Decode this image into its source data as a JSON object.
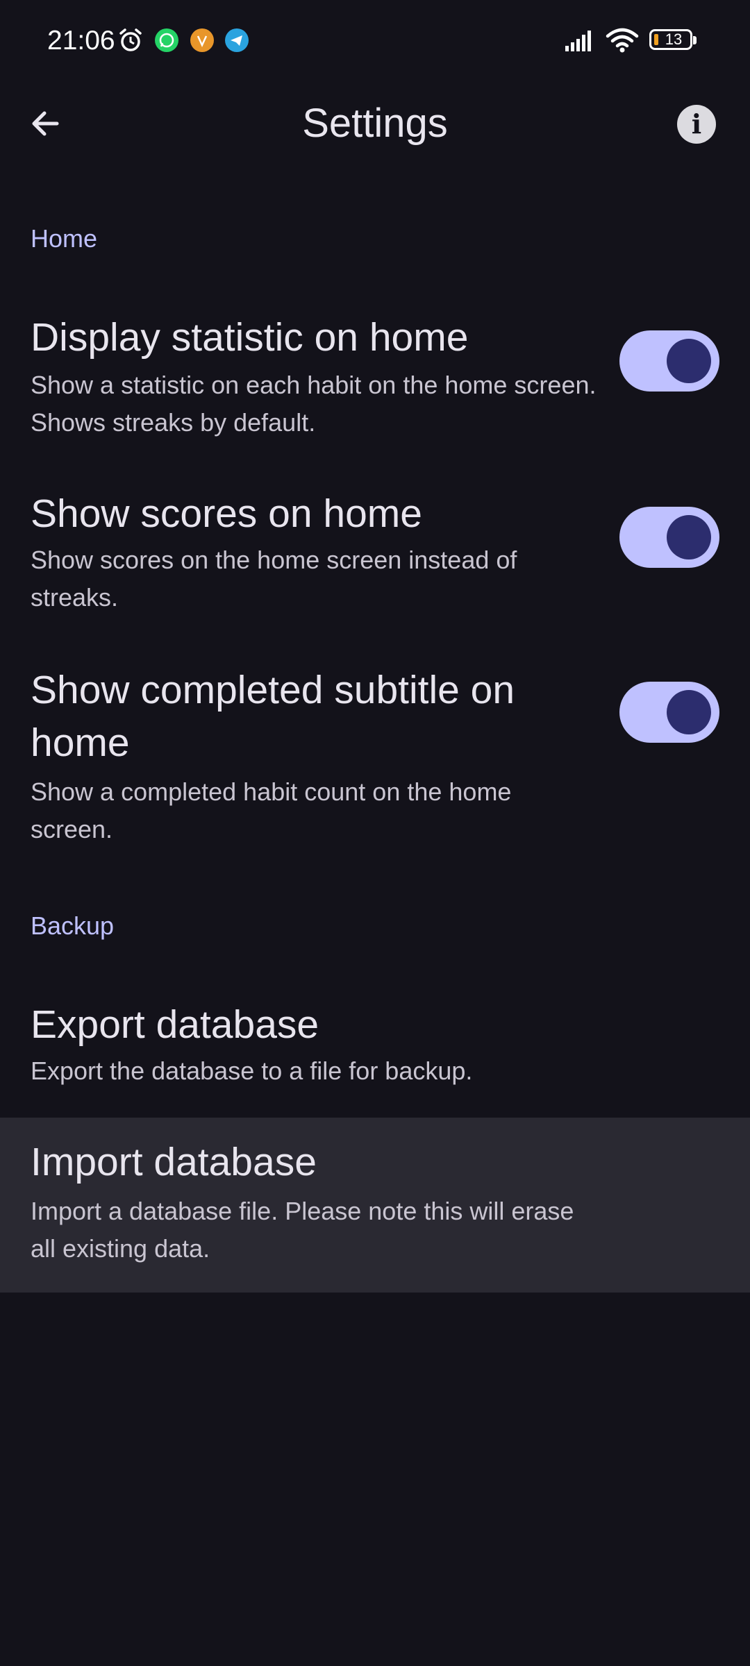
{
  "status_bar": {
    "time": "21:06",
    "battery": "13",
    "icons": [
      "alarm-icon",
      "whatsapp-icon",
      "app-notification-icon",
      "telegram-icon",
      "signal-icon",
      "wifi-icon",
      "battery-icon"
    ]
  },
  "app_bar": {
    "title": "Settings",
    "back_icon": "arrow-back-icon",
    "info_icon": "info-icon"
  },
  "sections": {
    "home": {
      "header": "Home",
      "items": [
        {
          "title": "Display statistic on home",
          "summary": "Show a statistic on each habit on the home screen. Shows streaks by default.",
          "enabled": true
        },
        {
          "title": "Show scores on home",
          "summary": "Show scores on the home screen instead of streaks.",
          "enabled": true
        },
        {
          "title": "Show completed subtitle on home",
          "summary": "Show a completed habit count on the home screen.",
          "enabled": true
        }
      ]
    },
    "backup": {
      "header": "Backup",
      "items": [
        {
          "title": "Export database",
          "summary": "Export the database to a file for backup."
        },
        {
          "title": "Import database",
          "summary": "Import a database file. Please note this will erase all existing data."
        }
      ]
    }
  },
  "colors": {
    "background": "#13121a",
    "accent": "#bfc1ff",
    "switch_knob": "#2c2d6e",
    "pressed_row": "#2a2932"
  }
}
